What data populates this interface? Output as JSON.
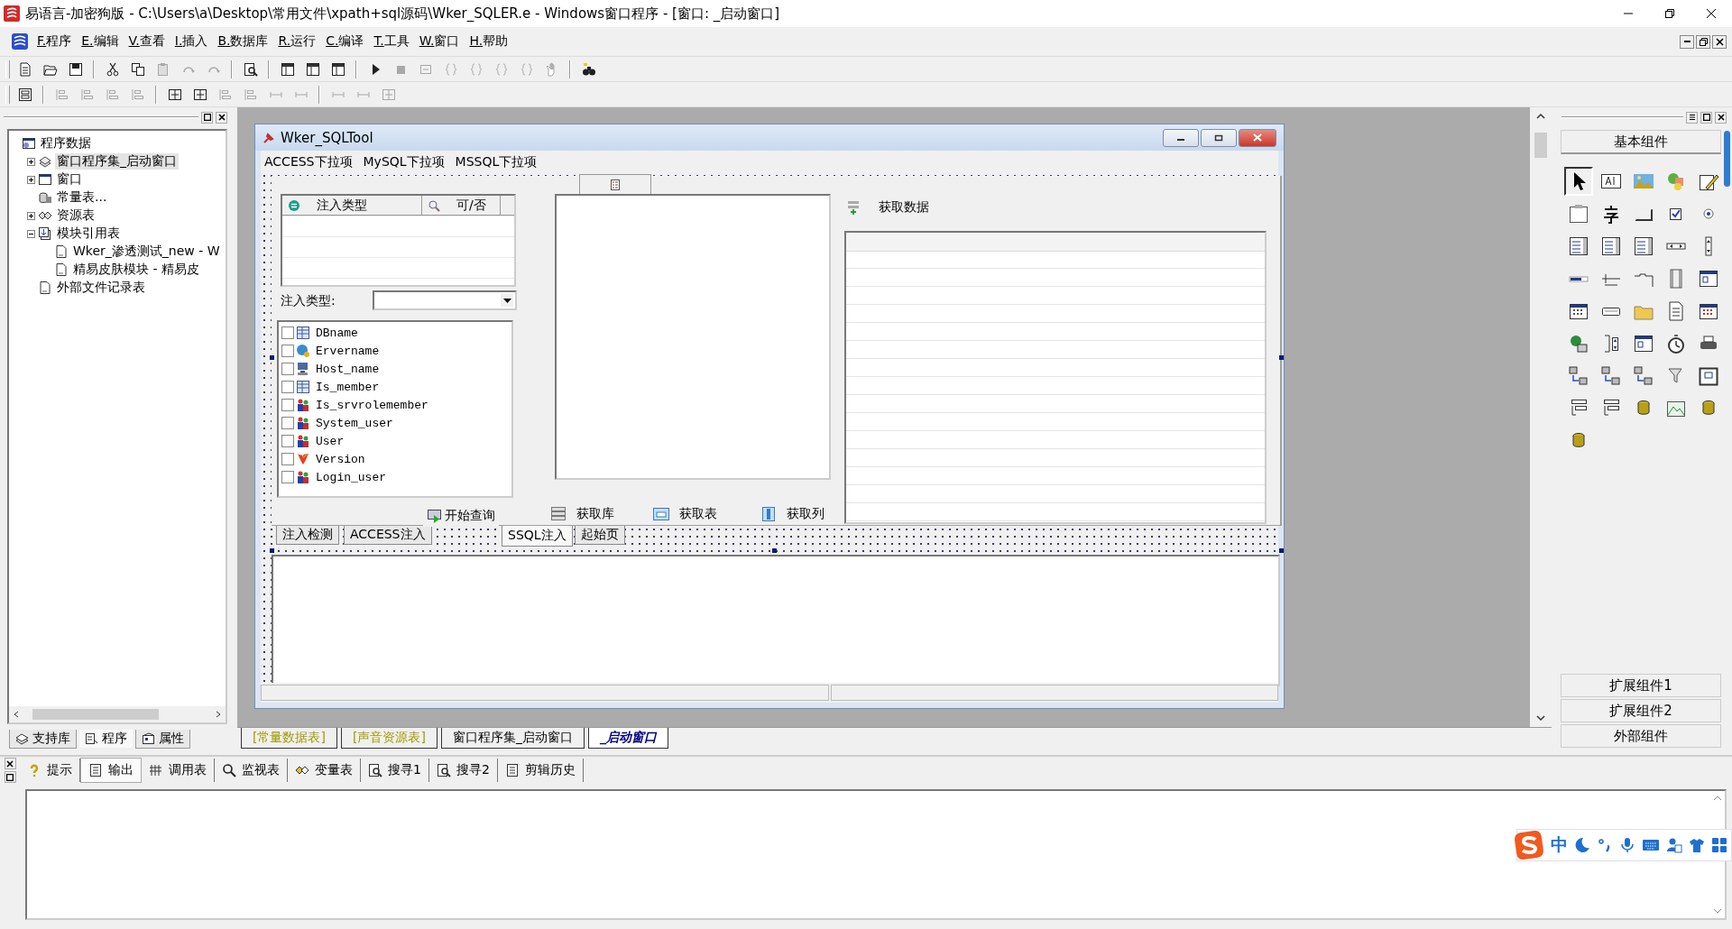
{
  "window": {
    "title": "易语言-加密狗版 - C:\\Users\\a\\Desktop\\常用文件\\xpath+sql源码\\Wker_SQLER.e - Windows窗口程序 - [窗口: _启动窗口]"
  },
  "menu": [
    "F.程序",
    "E.编辑",
    "V.查看",
    "I.插入",
    "B.数据库",
    "R.运行",
    "C.编译",
    "T.工具",
    "W.窗口",
    "H.帮助"
  ],
  "toolbar_1": [
    {
      "kind": "new",
      "disabled": false
    },
    {
      "kind": "open",
      "disabled": false
    },
    {
      "kind": "save",
      "disabled": false
    },
    {
      "kind": "separator"
    },
    {
      "kind": "cut",
      "disabled": false
    },
    {
      "kind": "copy",
      "disabled": false
    },
    {
      "kind": "paste",
      "disabled": true
    },
    {
      "kind": "redo",
      "disabled": true
    },
    {
      "kind": "undo",
      "disabled": true
    },
    {
      "kind": "separator"
    },
    {
      "kind": "find",
      "disabled": false
    },
    {
      "kind": "separator"
    },
    {
      "kind": "layout",
      "disabled": false
    },
    {
      "kind": "layout",
      "disabled": false
    },
    {
      "kind": "layout",
      "disabled": false
    },
    {
      "kind": "separator"
    },
    {
      "kind": "run",
      "disabled": false
    },
    {
      "kind": "stop",
      "disabled": true
    },
    {
      "kind": "step",
      "disabled": true
    },
    {
      "kind": "braces",
      "disabled": true
    },
    {
      "kind": "braces",
      "disabled": true
    },
    {
      "kind": "braces",
      "disabled": true
    },
    {
      "kind": "braces",
      "disabled": true
    },
    {
      "kind": "hand",
      "disabled": true
    },
    {
      "kind": "separator"
    },
    {
      "kind": "binoculars",
      "disabled": false
    }
  ],
  "toolbar_2": [
    {
      "kind": "form",
      "disabled": false
    },
    {
      "kind": "separator"
    },
    {
      "kind": "align",
      "disabled": true
    },
    {
      "kind": "align",
      "disabled": true
    },
    {
      "kind": "align",
      "disabled": true
    },
    {
      "kind": "align",
      "disabled": true
    },
    {
      "kind": "separator"
    },
    {
      "kind": "center",
      "disabled": false
    },
    {
      "kind": "center",
      "disabled": false
    },
    {
      "kind": "align",
      "disabled": true
    },
    {
      "kind": "align",
      "disabled": true
    },
    {
      "kind": "spacing",
      "disabled": true
    },
    {
      "kind": "spacing",
      "disabled": true
    },
    {
      "kind": "separator"
    },
    {
      "kind": "spacing",
      "disabled": true
    },
    {
      "kind": "spacing",
      "disabled": true
    },
    {
      "kind": "center",
      "disabled": true
    }
  ],
  "left_panel": {
    "tree": [
      {
        "label": "程序数据",
        "kind": "program",
        "expandable": false,
        "selected": false,
        "children": [
          {
            "label": "窗口程序集_启动窗口",
            "kind": "set",
            "expandable": true,
            "expanded": false,
            "selected": true
          },
          {
            "label": "窗口",
            "kind": "window",
            "expandable": true,
            "expanded": false,
            "selected": false
          },
          {
            "label": "常量表...",
            "kind": "constants",
            "expandable": false,
            "selected": false
          },
          {
            "label": "资源表",
            "kind": "resources",
            "expandable": true,
            "expanded": false,
            "selected": false
          },
          {
            "label": "模块引用表",
            "kind": "modules",
            "expandable": true,
            "expanded": true,
            "selected": false,
            "children": [
              {
                "label": "Wker_渗透测试_new - W",
                "kind": "file",
                "expandable": false,
                "selected": false
              },
              {
                "label": "精易皮肤模块 - 精易皮",
                "kind": "file",
                "expandable": false,
                "selected": false
              }
            ]
          },
          {
            "label": "外部文件记录表",
            "kind": "file",
            "expandable": false,
            "selected": false
          }
        ]
      }
    ],
    "tabs": [
      {
        "label": "支持库",
        "selected": false
      },
      {
        "label": "程序",
        "selected": true
      },
      {
        "label": "属性",
        "selected": false
      }
    ]
  },
  "designer": {
    "form": {
      "title": "Wker_SQLTool",
      "menu": [
        "ACCESS下拉项",
        "MySQL下拉项",
        "MSSQL下拉项"
      ],
      "inject_list": {
        "columns": [
          "注入类型",
          "可/否"
        ]
      },
      "type_label": "注入类型:",
      "checklist": [
        {
          "label": "DBname",
          "checked": false
        },
        {
          "label": "Ervername",
          "checked": false
        },
        {
          "label": "Host_name",
          "checked": false
        },
        {
          "label": "Is_member",
          "checked": false
        },
        {
          "label": "Is_srvrolemember",
          "checked": false
        },
        {
          "label": "System_user",
          "checked": false
        },
        {
          "label": "User",
          "checked": false
        },
        {
          "label": "Version",
          "checked": false
        },
        {
          "label": "Login_user",
          "checked": false
        }
      ],
      "query_button": "开始查询",
      "fetch_buttons": [
        "获取库",
        "获取表",
        "获取列"
      ],
      "fetch_data_label": "获取数据",
      "tabs": [
        {
          "label": "注入检测",
          "selected": false
        },
        {
          "label": "ACCESS注入",
          "selected": false
        },
        {
          "label": "SSQL注入",
          "selected": true
        },
        {
          "label": "起始页",
          "selected": false
        }
      ]
    },
    "tabs": [
      {
        "label": "[常量数据表]",
        "color": "#a09a00",
        "selected": false
      },
      {
        "label": "[声音资源表]",
        "color": "#a09a00",
        "selected": false
      },
      {
        "label": "窗口程序集_启动窗口",
        "color": "#000000",
        "selected": false
      },
      {
        "label": "_启动窗口",
        "color": "#000080",
        "selected": true
      }
    ]
  },
  "right_panel": {
    "title": "基本组件",
    "palette": [
      {
        "kind": "pointer",
        "selected": true
      },
      {
        "kind": "label",
        "selected": false
      },
      {
        "kind": "picture",
        "selected": false
      },
      {
        "kind": "shapes",
        "selected": false
      },
      {
        "kind": "pen",
        "selected": false
      },
      {
        "kind": "frame",
        "selected": false
      },
      {
        "kind": "character",
        "selected": false
      },
      {
        "kind": "button",
        "selected": false
      },
      {
        "kind": "checkbox",
        "selected": false
      },
      {
        "kind": "radio",
        "selected": false
      },
      {
        "kind": "combo",
        "selected": false
      },
      {
        "kind": "list",
        "selected": false
      },
      {
        "kind": "list",
        "selected": false
      },
      {
        "kind": "hscroll",
        "selected": false
      },
      {
        "kind": "vscroll",
        "selected": false
      },
      {
        "kind": "progress",
        "selected": false
      },
      {
        "kind": "slider",
        "selected": false
      },
      {
        "kind": "tabs",
        "selected": false
      },
      {
        "kind": "film",
        "selected": false
      },
      {
        "kind": "window",
        "selected": false
      },
      {
        "kind": "calendar",
        "selected": false
      },
      {
        "kind": "panel",
        "selected": false
      },
      {
        "kind": "folder",
        "selected": false
      },
      {
        "kind": "document",
        "selected": false
      },
      {
        "kind": "colors",
        "selected": false
      },
      {
        "kind": "globe",
        "selected": false
      },
      {
        "kind": "spinner",
        "selected": false
      },
      {
        "kind": "window",
        "selected": false
      },
      {
        "kind": "stopwatch",
        "selected": false
      },
      {
        "kind": "printer",
        "selected": false
      },
      {
        "kind": "computers",
        "selected": false
      },
      {
        "kind": "computers",
        "selected": false
      },
      {
        "kind": "computers",
        "selected": false
      },
      {
        "kind": "funnel",
        "selected": false
      },
      {
        "kind": "table",
        "selected": false
      },
      {
        "kind": "tree",
        "selected": false
      },
      {
        "kind": "tree",
        "selected": false
      },
      {
        "kind": "database",
        "selected": false
      },
      {
        "kind": "chart",
        "selected": false
      },
      {
        "kind": "database",
        "selected": false
      },
      {
        "kind": "database",
        "selected": false
      }
    ],
    "groups": [
      "扩展组件1",
      "扩展组件2",
      "外部组件"
    ]
  },
  "bottom_panel": {
    "tabs": [
      {
        "label": "提示",
        "selected": false
      },
      {
        "label": "输出",
        "selected": true
      },
      {
        "label": "调用表",
        "selected": false
      },
      {
        "label": "监视表",
        "selected": false
      },
      {
        "label": "变量表",
        "selected": false
      },
      {
        "label": "搜寻1",
        "selected": false
      },
      {
        "label": "搜寻2",
        "selected": false
      },
      {
        "label": "剪辑历史",
        "selected": false
      }
    ]
  },
  "ime_bar": {
    "mode": "中"
  }
}
